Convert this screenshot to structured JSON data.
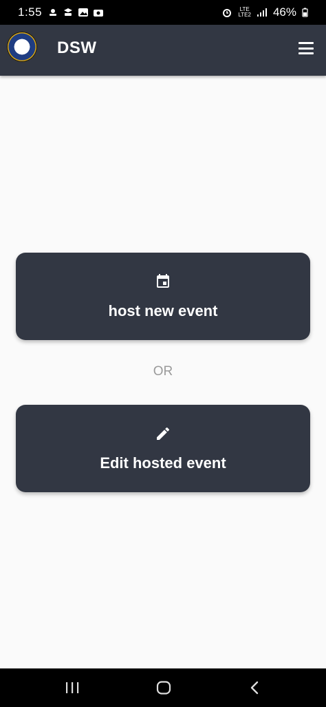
{
  "status_bar": {
    "time": "1:55",
    "network": "LTE",
    "network_sub": "LTE2",
    "battery": "46%"
  },
  "app_bar": {
    "title": "DSW",
    "logo_icon": "institution-seal-logo",
    "menu_icon": "hamburger-menu-icon"
  },
  "actions": {
    "host": {
      "label": "host new event",
      "icon": "calendar-icon"
    },
    "separator": "OR",
    "edit": {
      "label": "Edit hosted event",
      "icon": "pencil-icon"
    }
  },
  "nav_bar": {
    "recents_icon": "recents-icon",
    "home_icon": "home-icon",
    "back_icon": "back-icon"
  },
  "colors": {
    "app_bar": "#323743",
    "card": "#323743",
    "background": "#fafafa",
    "separator_text": "#9a9a9a"
  }
}
